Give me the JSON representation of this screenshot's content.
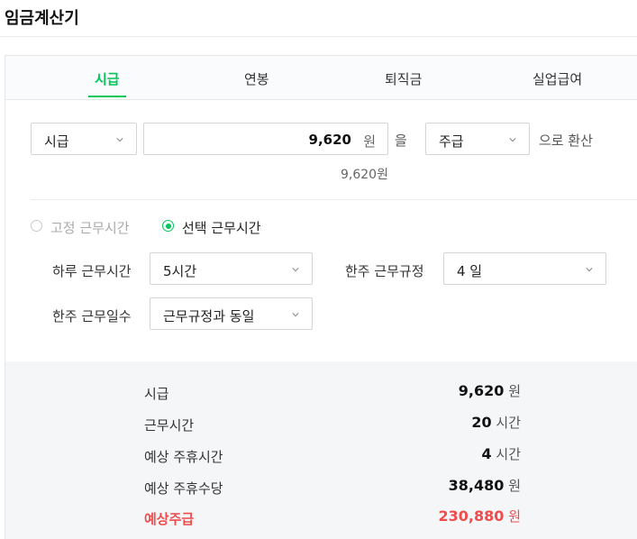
{
  "page": {
    "title": "임금계산기"
  },
  "tabs": [
    {
      "label": "시급",
      "active": true
    },
    {
      "label": "연봉",
      "active": false
    },
    {
      "label": "퇴직금",
      "active": false
    },
    {
      "label": "실업급여",
      "active": false
    }
  ],
  "converter": {
    "from_unit": "시급",
    "amount": "9,620",
    "amount_unit": "원",
    "particle": "을",
    "to_unit": "주급",
    "suffix": "으로 환산",
    "converted_text": "9,620원"
  },
  "work_time": {
    "fixed_label": "고정 근무시간",
    "fixed_selected": false,
    "custom_label": "선택 근무시간",
    "custom_selected": true,
    "daily_hours_label": "하루 근무시간",
    "daily_hours_value": "5시간",
    "weekly_rule_label": "한주 근무규정",
    "weekly_rule_value": "4 일",
    "weekly_days_label": "한주 근무일수",
    "weekly_days_value": "근무규정과 동일"
  },
  "summary": [
    {
      "label": "시급",
      "value": "9,620",
      "unit": "원",
      "highlight": false
    },
    {
      "label": "근무시간",
      "value": "20",
      "unit": "시간",
      "highlight": false
    },
    {
      "label": "예상 주휴시간",
      "value": "4",
      "unit": "시간",
      "highlight": false
    },
    {
      "label": "예상 주휴수당",
      "value": "38,480",
      "unit": "원",
      "highlight": false
    },
    {
      "label": "예상주급",
      "value": "230,880",
      "unit": "원",
      "highlight": true
    }
  ],
  "colors": {
    "accent": "#03c75a",
    "highlight": "#f04c4c",
    "summary_bg": "#f5f6f8"
  },
  "icons": {
    "select_arrow": "chevron-down-icon"
  }
}
